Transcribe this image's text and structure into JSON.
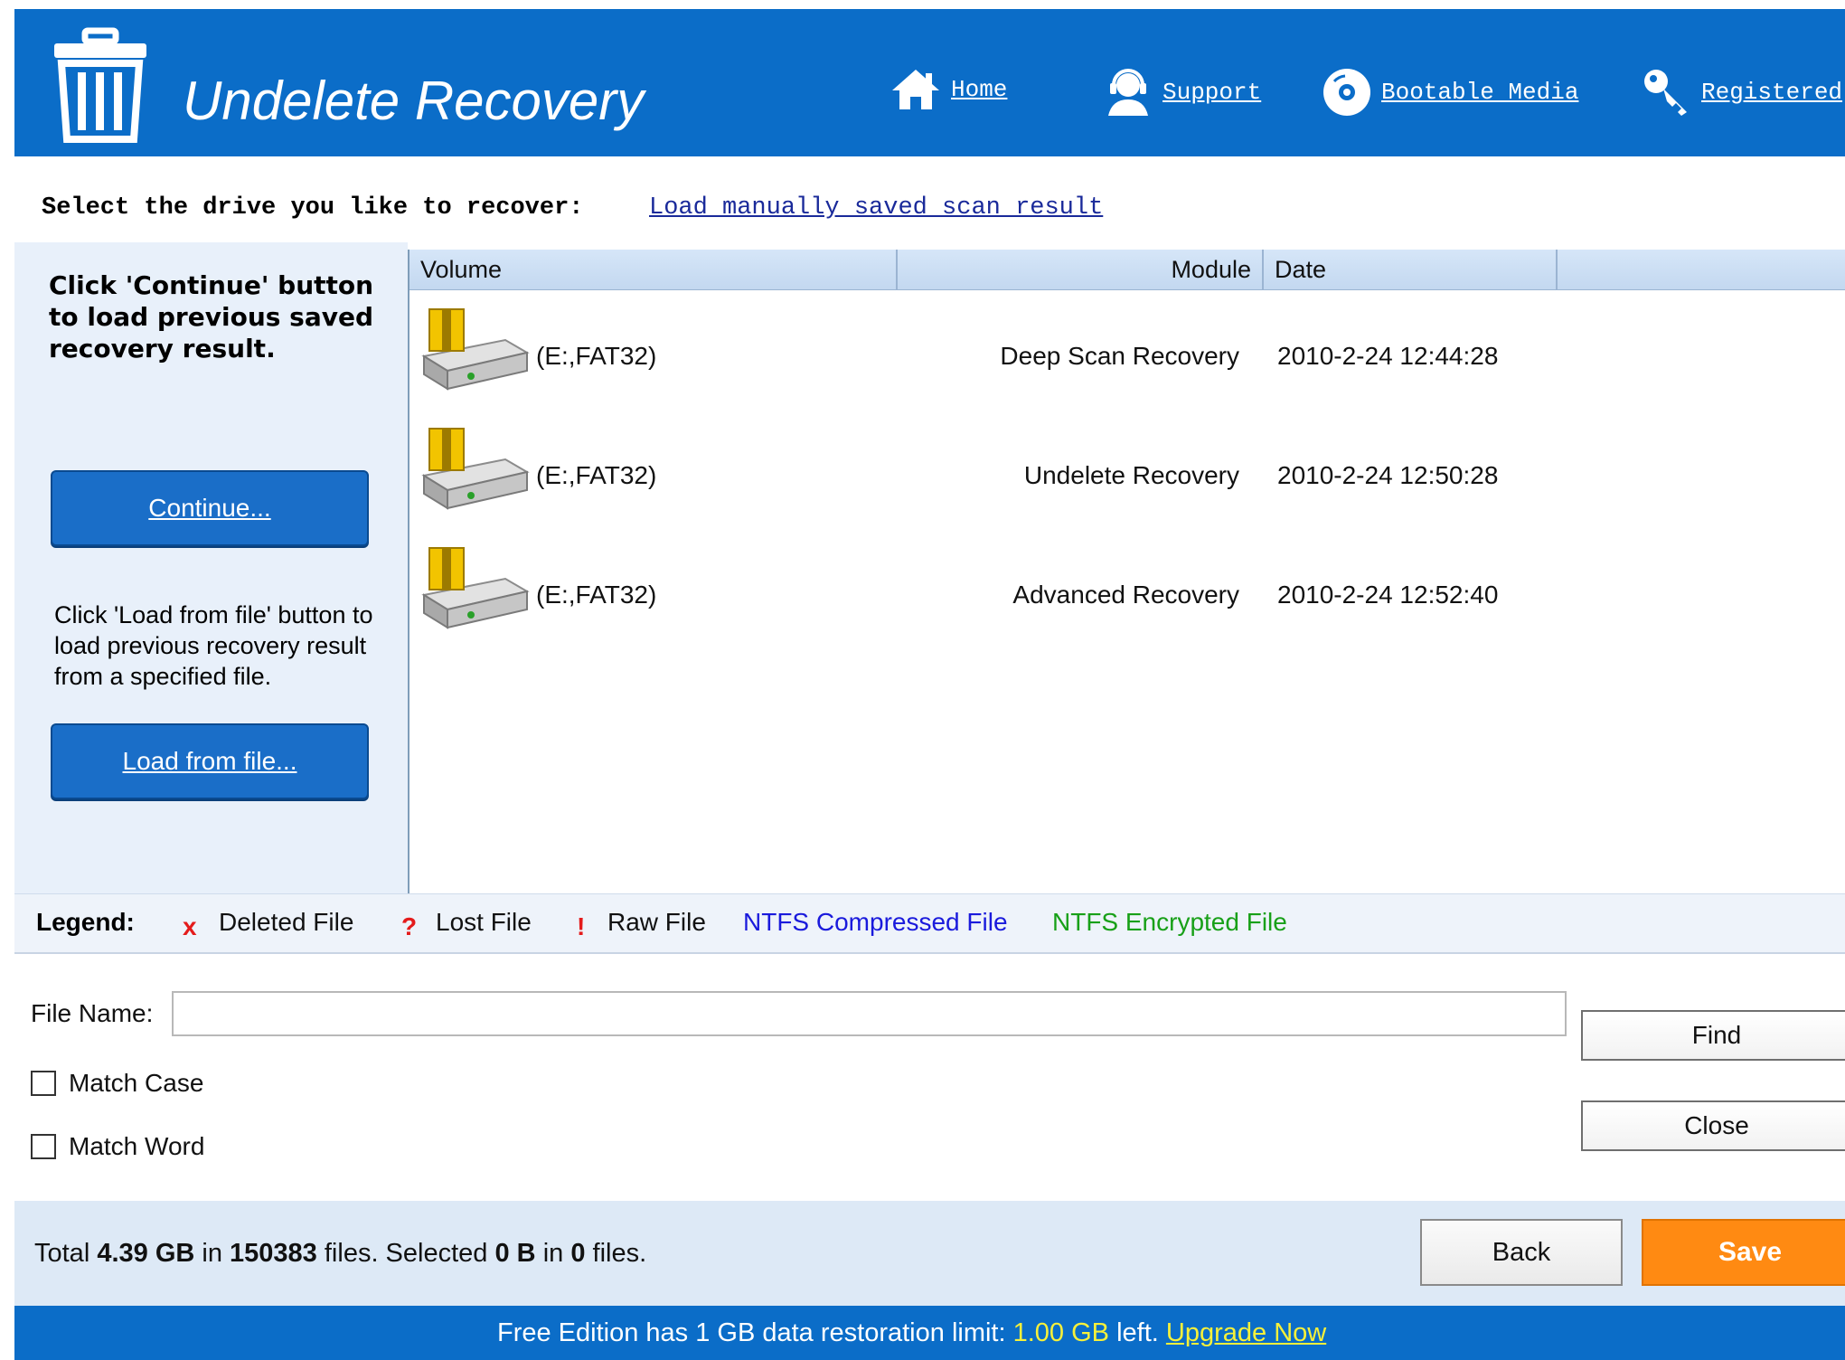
{
  "header": {
    "title": "Undelete Recovery",
    "nav": [
      {
        "label": "Home",
        "icon": "home-icon"
      },
      {
        "label": "Support",
        "icon": "support-agent-icon"
      },
      {
        "label": "Bootable Media",
        "icon": "disc-icon"
      },
      {
        "label": "Registered",
        "icon": "key-icon"
      }
    ]
  },
  "prompt": {
    "text": "Select the drive you like to recover:",
    "link": "Load manually saved scan result"
  },
  "left_panel": {
    "text1": "Click 'Continue' button to load previous saved recovery result.",
    "continue_label": "Continue...",
    "text2": "Click 'Load from file' button to load previous recovery result from a specified file.",
    "load_label": "Load from file..."
  },
  "table": {
    "columns": [
      "Volume",
      "Module",
      "Date"
    ],
    "rows": [
      {
        "volume": "(E:,FAT32)",
        "module": "Deep Scan Recovery",
        "date": "2010-2-24 12:44:28"
      },
      {
        "volume": "(E:,FAT32)",
        "module": "Undelete Recovery",
        "date": "2010-2-24 12:50:28"
      },
      {
        "volume": "(E:,FAT32)",
        "module": "Advanced Recovery",
        "date": "2010-2-24 12:52:40"
      }
    ]
  },
  "legend": {
    "title": "Legend:",
    "deleted_mark": "x",
    "deleted": "Deleted File",
    "lost_mark": "?",
    "lost": "Lost File",
    "raw_mark": "!",
    "raw": "Raw File",
    "compressed": "NTFS Compressed File",
    "encrypted": "NTFS Encrypted File"
  },
  "find": {
    "file_name_label": "File Name:",
    "file_name_value": "",
    "match_case": "Match Case",
    "match_word": "Match Word",
    "find_label": "Find",
    "close_label": "Close"
  },
  "status": {
    "total_prefix": "Total",
    "total_size": "4.39 GB",
    "in1": "in",
    "total_files": "150383",
    "files_selected": "files.  Selected",
    "selected_size": "0 B",
    "in2": "in",
    "selected_files": "0",
    "files_end": "files.",
    "back_label": "Back",
    "save_label": "Save"
  },
  "footer": {
    "text": "Free Edition has 1 GB data restoration limit:",
    "left_value": "1.00 GB",
    "left_suffix": "left.",
    "upgrade": "Upgrade Now"
  },
  "colors": {
    "brand_blue": "#0b6dc8",
    "save_orange": "#ff8a12",
    "legend_red": "#e41b1b",
    "compressed_blue": "#1a1adc",
    "encrypted_green": "#18a018",
    "footer_highlight": "#f6f03a"
  }
}
